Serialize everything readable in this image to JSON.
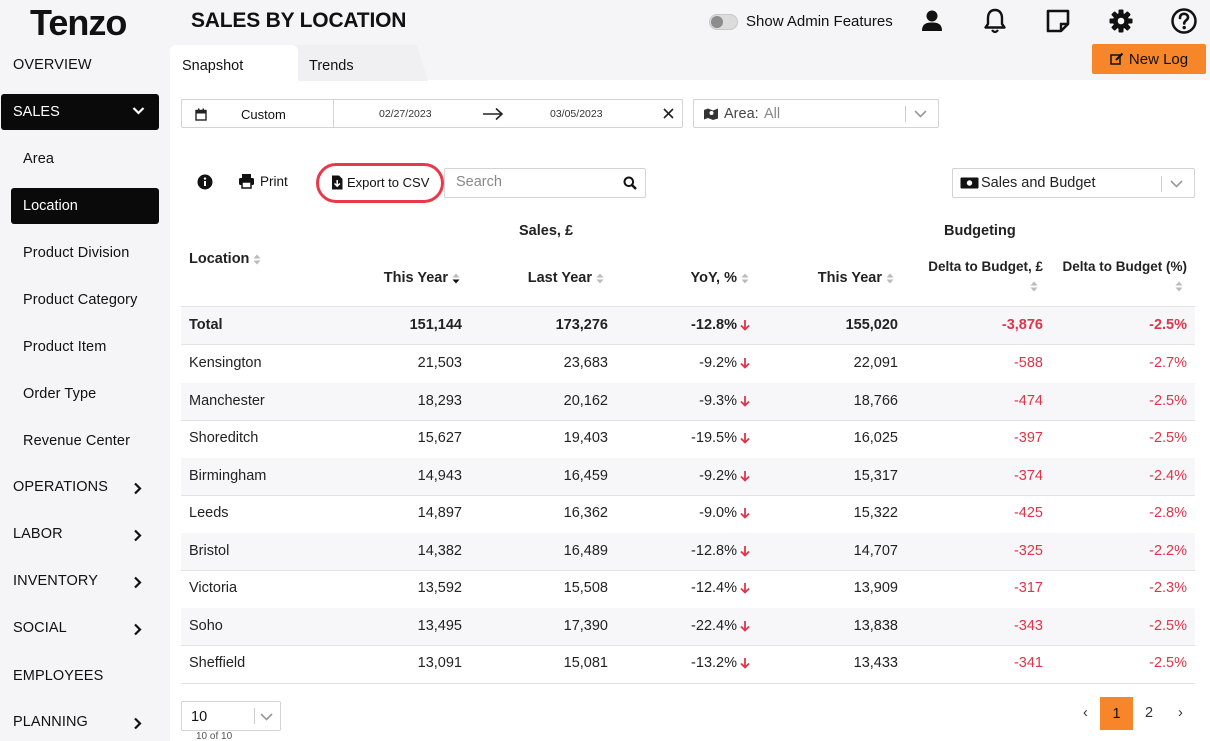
{
  "app": {
    "logo": "Tenzo",
    "page_title": "SALES BY LOCATION"
  },
  "header": {
    "admin_toggle_label": "Show Admin Features",
    "admin_enabled": false
  },
  "sidebar": {
    "overview": "OVERVIEW",
    "sales": "SALES",
    "sales_sub": [
      "Area",
      "Location",
      "Product Division",
      "Product Category",
      "Product Item",
      "Order Type",
      "Revenue Center"
    ],
    "operations": "OPERATIONS",
    "labor": "LABOR",
    "inventory": "INVENTORY",
    "social": "SOCIAL",
    "employees": "EMPLOYEES",
    "planning": "PLANNING"
  },
  "tabs": {
    "snapshot": "Snapshot",
    "trends": "Trends"
  },
  "new_log": "New Log",
  "filters": {
    "date_mode": "Custom",
    "date_from": "02/27/2023",
    "date_to": "03/05/2023",
    "area_label": "Area:",
    "area_value": "All"
  },
  "toolbar": {
    "print": "Print",
    "export": "Export to CSV",
    "search_placeholder": "Search",
    "metric": "Sales and Budget"
  },
  "table": {
    "group_sales": "Sales, £",
    "group_budget": "Budgeting",
    "col_location": "Location",
    "col_this_year": "This Year",
    "col_last_year": "Last Year",
    "col_yoy": "YoY, %",
    "col_budget_this_year": "This Year",
    "col_delta_budget": "Delta to Budget, £",
    "col_delta_budget_pct": "Delta to Budget (%)",
    "total": {
      "location": "Total",
      "this_year": "151,144",
      "last_year": "173,276",
      "yoy": "-12.8%",
      "budget": "155,020",
      "delta": "-3,876",
      "delta_pct": "-2.5%"
    },
    "rows": [
      {
        "location": "Kensington",
        "this_year": "21,503",
        "last_year": "23,683",
        "yoy": "-9.2%",
        "budget": "22,091",
        "delta": "-588",
        "delta_pct": "-2.7%"
      },
      {
        "location": "Manchester",
        "this_year": "18,293",
        "last_year": "20,162",
        "yoy": "-9.3%",
        "budget": "18,766",
        "delta": "-474",
        "delta_pct": "-2.5%"
      },
      {
        "location": "Shoreditch",
        "this_year": "15,627",
        "last_year": "19,403",
        "yoy": "-19.5%",
        "budget": "16,025",
        "delta": "-397",
        "delta_pct": "-2.5%"
      },
      {
        "location": "Birmingham",
        "this_year": "14,943",
        "last_year": "16,459",
        "yoy": "-9.2%",
        "budget": "15,317",
        "delta": "-374",
        "delta_pct": "-2.4%"
      },
      {
        "location": "Leeds",
        "this_year": "14,897",
        "last_year": "16,362",
        "yoy": "-9.0%",
        "budget": "15,322",
        "delta": "-425",
        "delta_pct": "-2.8%"
      },
      {
        "location": "Bristol",
        "this_year": "14,382",
        "last_year": "16,489",
        "yoy": "-12.8%",
        "budget": "14,707",
        "delta": "-325",
        "delta_pct": "-2.2%"
      },
      {
        "location": "Victoria",
        "this_year": "13,592",
        "last_year": "15,508",
        "yoy": "-12.4%",
        "budget": "13,909",
        "delta": "-317",
        "delta_pct": "-2.3%"
      },
      {
        "location": "Soho",
        "this_year": "13,495",
        "last_year": "17,390",
        "yoy": "-22.4%",
        "budget": "13,838",
        "delta": "-343",
        "delta_pct": "-2.5%"
      },
      {
        "location": "Sheffield",
        "this_year": "13,091",
        "last_year": "15,081",
        "yoy": "-13.2%",
        "budget": "13,433",
        "delta": "-341",
        "delta_pct": "-2.5%"
      }
    ]
  },
  "footer": {
    "page_size": "10",
    "count": "10 of 10",
    "pages": [
      "1",
      "2"
    ],
    "current_page": "1",
    "prev": "‹",
    "next": "›"
  },
  "colors": {
    "accent": "#f7862a",
    "negative": "#e0344a",
    "highlight": "#e8394a"
  }
}
